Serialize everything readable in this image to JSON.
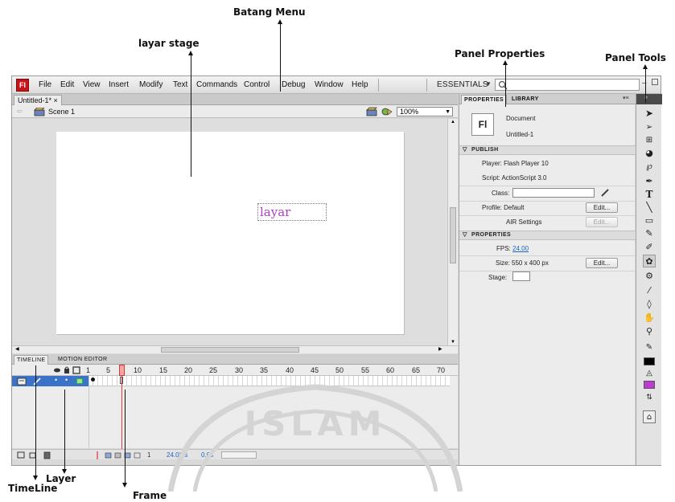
{
  "annotations": {
    "batang_menu": "Batang Menu",
    "layar_stage": "layar stage",
    "panel_properties": "Panel Properties",
    "panel_tools": "Panel Tools",
    "timeline": "TimeLine",
    "layer": "Layer",
    "frame": "Frame"
  },
  "watermark": "ISLAM",
  "app": {
    "logo": "Fl",
    "menu": [
      "File",
      "Edit",
      "View",
      "Insert",
      "Modify",
      "Text",
      "Commands",
      "Control",
      "Debug",
      "Window",
      "Help"
    ],
    "workspace": "ESSENTIALS",
    "document_tab": "Untitled-1*",
    "scene": "Scene 1",
    "zoom": "100%",
    "stage_text": "layar"
  },
  "timeline": {
    "tabs": [
      "TIMELINE",
      "MOTION EDITOR"
    ],
    "frame_numbers": [
      "1",
      "5",
      "10",
      "15",
      "20",
      "25",
      "30",
      "35",
      "40",
      "45",
      "50",
      "55",
      "60",
      "65",
      "70"
    ],
    "fps": "24.0fps",
    "time": "0.0s",
    "current_frame": "1"
  },
  "properties": {
    "tabs": [
      "PROPERTIES",
      "LIBRARY"
    ],
    "doc_icon": "Fl",
    "doc_type": "Document",
    "doc_name": "Untitled-1",
    "publish_header": "PUBLISH",
    "player": "Player: Flash Player 10",
    "script": "Script: ActionScript 3.0",
    "class_label": "Class:",
    "profile": "Profile: Default",
    "edit_btn": "Edit...",
    "air": "AIR Settings",
    "props_header": "PROPERTIES",
    "fps_label": "FPS:",
    "fps_value": "24.00",
    "size": "Size: 550 x 400 px",
    "stage_label": "Stage:"
  },
  "colors": {
    "stage_text": "#b03cc9",
    "fill_swatch": "#c23ad6",
    "stroke_swatch": "#000000",
    "stage_swatch": "#ffffff",
    "logo_red": "#c8131b",
    "layer_blue": "#3a73c7"
  }
}
